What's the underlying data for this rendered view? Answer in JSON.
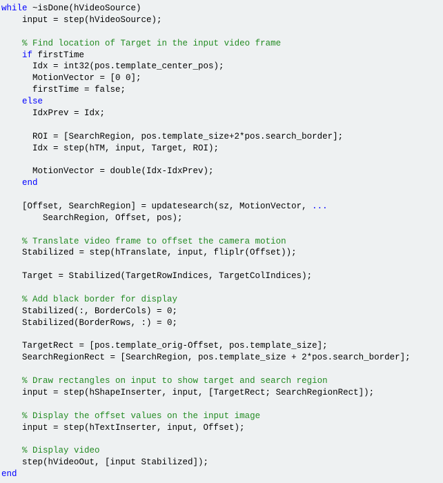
{
  "code": {
    "lines": [
      {
        "segs": [
          {
            "cls": "kw",
            "t": "while"
          },
          {
            "cls": "",
            "t": " ~isDone(hVideoSource)"
          }
        ]
      },
      {
        "segs": [
          {
            "cls": "",
            "t": "    input = step(hVideoSource);"
          }
        ]
      },
      {
        "segs": [
          {
            "cls": "",
            "t": ""
          }
        ]
      },
      {
        "segs": [
          {
            "cls": "",
            "t": "    "
          },
          {
            "cls": "cm",
            "t": "% Find location of Target in the input video frame"
          }
        ]
      },
      {
        "segs": [
          {
            "cls": "",
            "t": "    "
          },
          {
            "cls": "kw",
            "t": "if"
          },
          {
            "cls": "",
            "t": " firstTime"
          }
        ]
      },
      {
        "segs": [
          {
            "cls": "",
            "t": "      Idx = int32(pos.template_center_pos);"
          }
        ]
      },
      {
        "segs": [
          {
            "cls": "",
            "t": "      MotionVector = [0 0];"
          }
        ]
      },
      {
        "segs": [
          {
            "cls": "",
            "t": "      firstTime = false;"
          }
        ]
      },
      {
        "segs": [
          {
            "cls": "",
            "t": "    "
          },
          {
            "cls": "kw",
            "t": "else"
          }
        ]
      },
      {
        "segs": [
          {
            "cls": "",
            "t": "      IdxPrev = Idx;"
          }
        ]
      },
      {
        "segs": [
          {
            "cls": "",
            "t": ""
          }
        ]
      },
      {
        "segs": [
          {
            "cls": "",
            "t": "      ROI = [SearchRegion, pos.template_size+2*pos.search_border];"
          }
        ]
      },
      {
        "segs": [
          {
            "cls": "",
            "t": "      Idx = step(hTM, input, Target, ROI);"
          }
        ]
      },
      {
        "segs": [
          {
            "cls": "",
            "t": ""
          }
        ]
      },
      {
        "segs": [
          {
            "cls": "",
            "t": "      MotionVector = double(Idx-IdxPrev);"
          }
        ]
      },
      {
        "segs": [
          {
            "cls": "",
            "t": "    "
          },
          {
            "cls": "kw",
            "t": "end"
          }
        ]
      },
      {
        "segs": [
          {
            "cls": "",
            "t": ""
          }
        ]
      },
      {
        "segs": [
          {
            "cls": "",
            "t": "    [Offset, SearchRegion] = updatesearch(sz, MotionVector, "
          },
          {
            "cls": "kw",
            "t": "..."
          }
        ]
      },
      {
        "segs": [
          {
            "cls": "",
            "t": "        SearchRegion, Offset, pos);"
          }
        ]
      },
      {
        "segs": [
          {
            "cls": "",
            "t": ""
          }
        ]
      },
      {
        "segs": [
          {
            "cls": "",
            "t": "    "
          },
          {
            "cls": "cm",
            "t": "% Translate video frame to offset the camera motion"
          }
        ]
      },
      {
        "segs": [
          {
            "cls": "",
            "t": "    Stabilized = step(hTranslate, input, fliplr(Offset));"
          }
        ]
      },
      {
        "segs": [
          {
            "cls": "",
            "t": ""
          }
        ]
      },
      {
        "segs": [
          {
            "cls": "",
            "t": "    Target = Stabilized(TargetRowIndices, TargetColIndices);"
          }
        ]
      },
      {
        "segs": [
          {
            "cls": "",
            "t": ""
          }
        ]
      },
      {
        "segs": [
          {
            "cls": "",
            "t": "    "
          },
          {
            "cls": "cm",
            "t": "% Add black border for display"
          }
        ]
      },
      {
        "segs": [
          {
            "cls": "",
            "t": "    Stabilized(:, BorderCols) = 0;"
          }
        ]
      },
      {
        "segs": [
          {
            "cls": "",
            "t": "    Stabilized(BorderRows, :) = 0;"
          }
        ]
      },
      {
        "segs": [
          {
            "cls": "",
            "t": ""
          }
        ]
      },
      {
        "segs": [
          {
            "cls": "",
            "t": "    TargetRect = [pos.template_orig-Offset, pos.template_size];"
          }
        ]
      },
      {
        "segs": [
          {
            "cls": "",
            "t": "    SearchRegionRect = [SearchRegion, pos.template_size + 2*pos.search_border];"
          }
        ]
      },
      {
        "segs": [
          {
            "cls": "",
            "t": ""
          }
        ]
      },
      {
        "segs": [
          {
            "cls": "",
            "t": "    "
          },
          {
            "cls": "cm",
            "t": "% Draw rectangles on input to show target and search region"
          }
        ]
      },
      {
        "segs": [
          {
            "cls": "",
            "t": "    input = step(hShapeInserter, input, [TargetRect; SearchRegionRect]);"
          }
        ]
      },
      {
        "segs": [
          {
            "cls": "",
            "t": ""
          }
        ]
      },
      {
        "segs": [
          {
            "cls": "",
            "t": "    "
          },
          {
            "cls": "cm",
            "t": "% Display the offset values on the input image"
          }
        ]
      },
      {
        "segs": [
          {
            "cls": "",
            "t": "    input = step(hTextInserter, input, Offset);"
          }
        ]
      },
      {
        "segs": [
          {
            "cls": "",
            "t": ""
          }
        ]
      },
      {
        "segs": [
          {
            "cls": "",
            "t": "    "
          },
          {
            "cls": "cm",
            "t": "% Display video"
          }
        ]
      },
      {
        "segs": [
          {
            "cls": "",
            "t": "    step(hVideoOut, [input Stabilized]);"
          }
        ]
      },
      {
        "segs": [
          {
            "cls": "kw",
            "t": "end"
          }
        ]
      }
    ]
  }
}
